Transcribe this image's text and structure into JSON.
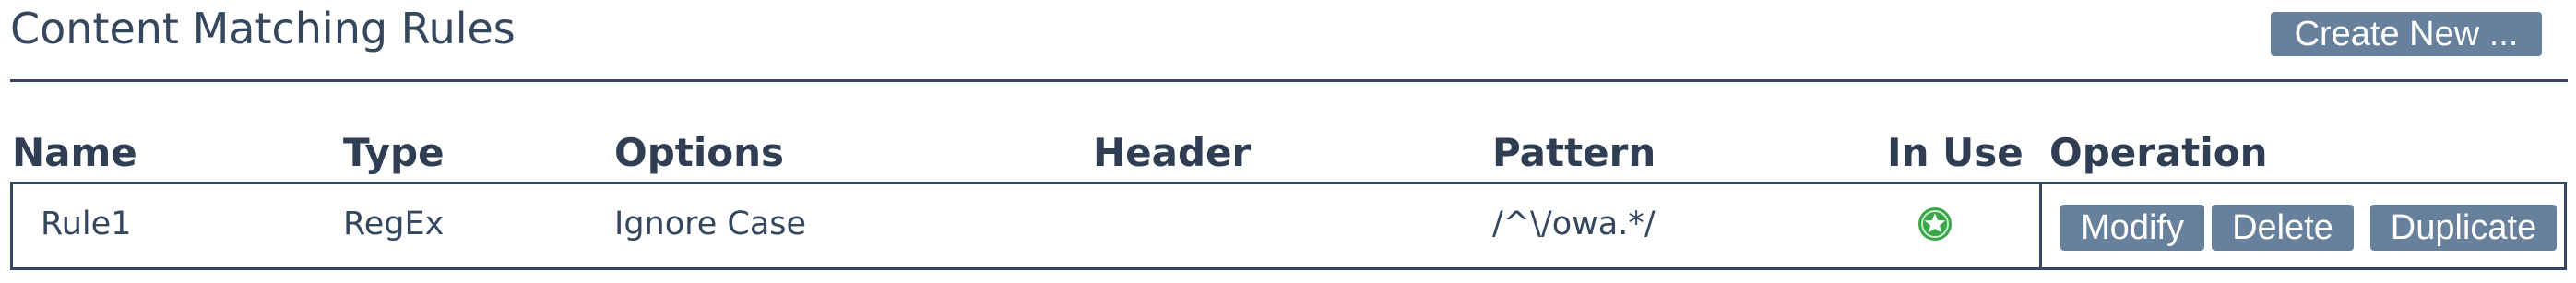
{
  "page": {
    "title": "Content Matching Rules",
    "create_button_label": "Create New ..."
  },
  "table": {
    "columns": [
      "Name",
      "Type",
      "Options",
      "Header",
      "Pattern",
      "In Use",
      "Operation"
    ],
    "rows": [
      {
        "name": "Rule1",
        "type": "RegEx",
        "options": "Ignore Case",
        "header": "",
        "pattern": "/^\\/owa.*/",
        "in_use_icon": "check-circle-icon",
        "operations": [
          "Modify",
          "Delete",
          "Duplicate"
        ]
      }
    ]
  },
  "colors": {
    "text": "#34475f",
    "button_bg": "#67809b",
    "button_text": "#ffffff",
    "in_use_green": "#3aa64a"
  }
}
